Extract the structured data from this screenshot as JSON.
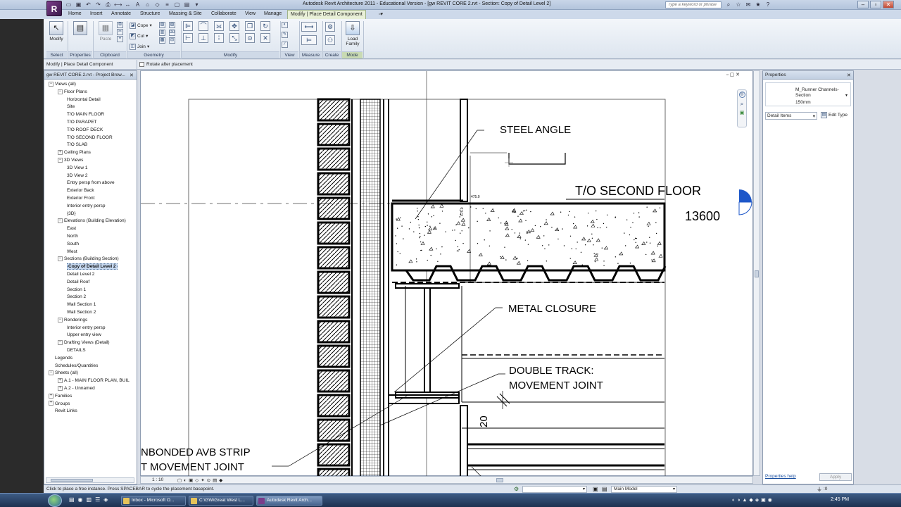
{
  "window": {
    "title": "Autodesk Revit Architecture 2011 - Educational Version - [gw REVIT CORE 2.rvt - Section: Copy of Detail Level 2]",
    "search_placeholder": "Type a keyword or phrase"
  },
  "tabs": [
    "Home",
    "Insert",
    "Annotate",
    "Structure",
    "Massing & Site",
    "Collaborate",
    "View",
    "Manage"
  ],
  "active_tab": "Modify | Place Detail Component",
  "ribbon": {
    "modify_label": "Modify",
    "properties_label": "Properties",
    "paste_label": "Paste",
    "cope_label": "Cope",
    "cut_label": "Cut",
    "join_label": "Join",
    "load_family_label": "Load Family",
    "panels": {
      "select": "Select",
      "properties": "Properties",
      "clipboard": "Clipboard",
      "geometry": "Geometry",
      "modify": "Modify",
      "view": "View",
      "measure": "Measure",
      "create": "Create",
      "mode": "Mode"
    }
  },
  "options_bar": {
    "context": "Modify | Place Detail Component",
    "rotate_label": "Rotate after placement",
    "rotate_checked": false
  },
  "project_browser": {
    "title": "gw REVIT CORE 2.rvt - Project Brow...",
    "views_all": "Views (all)",
    "floor_plans": "Floor Plans",
    "floor_plan_items": [
      "Horizontal Detail",
      "Site",
      "T/O MAIN FLOOR",
      "T/O PARAPET",
      "T/O ROOF DECK",
      "T/O SECOND FLOOR",
      "T/O SLAB"
    ],
    "ceiling_plans": "Ceiling Plans",
    "views_3d": "3D Views",
    "views_3d_items": [
      "3D View 1",
      "3D View 2",
      "Entry persp from above",
      "Exterior Back",
      "Exterior Front",
      "Interior entry persp",
      "{3D}"
    ],
    "elevations": "Elevations (Building Elevation)",
    "elevation_items": [
      "East",
      "North",
      "South",
      "West"
    ],
    "sections": "Sections (Building Section)",
    "section_items": [
      "Copy of Detail Level 2",
      "Detail Level 2",
      "Detail Roof",
      "Section 1",
      "Section 2",
      "Wall Section 1",
      "Wall Section 2"
    ],
    "renderings": "Renderings",
    "rendering_items": [
      "Interior entry persp",
      "Upper entry view"
    ],
    "drafting": "Drafting Views (Detail)",
    "drafting_items": [
      "DETAILS"
    ],
    "legends": "Legends",
    "schedules": "Schedules/Quantities",
    "sheets": "Sheets (all)",
    "sheet_items": [
      "A.1 - MAIN FLOOR PLAN, BUIL",
      "A.2 - Unnamed"
    ],
    "families": "Families",
    "groups": "Groups",
    "revit_links": "Revit Links"
  },
  "drawing": {
    "label_steel_angle": "STEEL ANGLE",
    "label_second_floor": "T/O SECOND FLOOR",
    "label_elevation": "13600",
    "label_metal_closure": "METAL CLOSURE",
    "label_double_track_1": "DOUBLE TRACK:",
    "label_double_track_2": "MOVEMENT JOINT",
    "label_dim_20": "20",
    "label_avb_1": "NBONDED AVB STRIP",
    "label_avb_2": "T MOVEMENT JOINT",
    "dim_small_1": "475.0",
    "dim_small_2": "475.0",
    "scale": "1 : 10"
  },
  "properties_panel": {
    "title": "Properties",
    "type_name": "M_Runner Channels-Section",
    "type_size": "150mm",
    "category": "Detail Items",
    "edit_type": "Edit Type",
    "help": "Properties help",
    "apply": "Apply"
  },
  "status": {
    "hint": "Click to place a free instance. Press SPACEBAR to cycle the placement basepoint.",
    "model": "Main Model",
    "filter_count": ":0"
  },
  "taskbar": {
    "items": [
      "Inbox - Microsoft O...",
      "C:\\GW\\Great West L...",
      "Autodesk Revit Arch..."
    ],
    "time": "2:45 PM"
  },
  "colors": {
    "accent_context_tab": "#e9f0d8",
    "taskbar": "#1d3150",
    "selection": "#c4d7f0",
    "view_cube": "#1d57c9"
  }
}
